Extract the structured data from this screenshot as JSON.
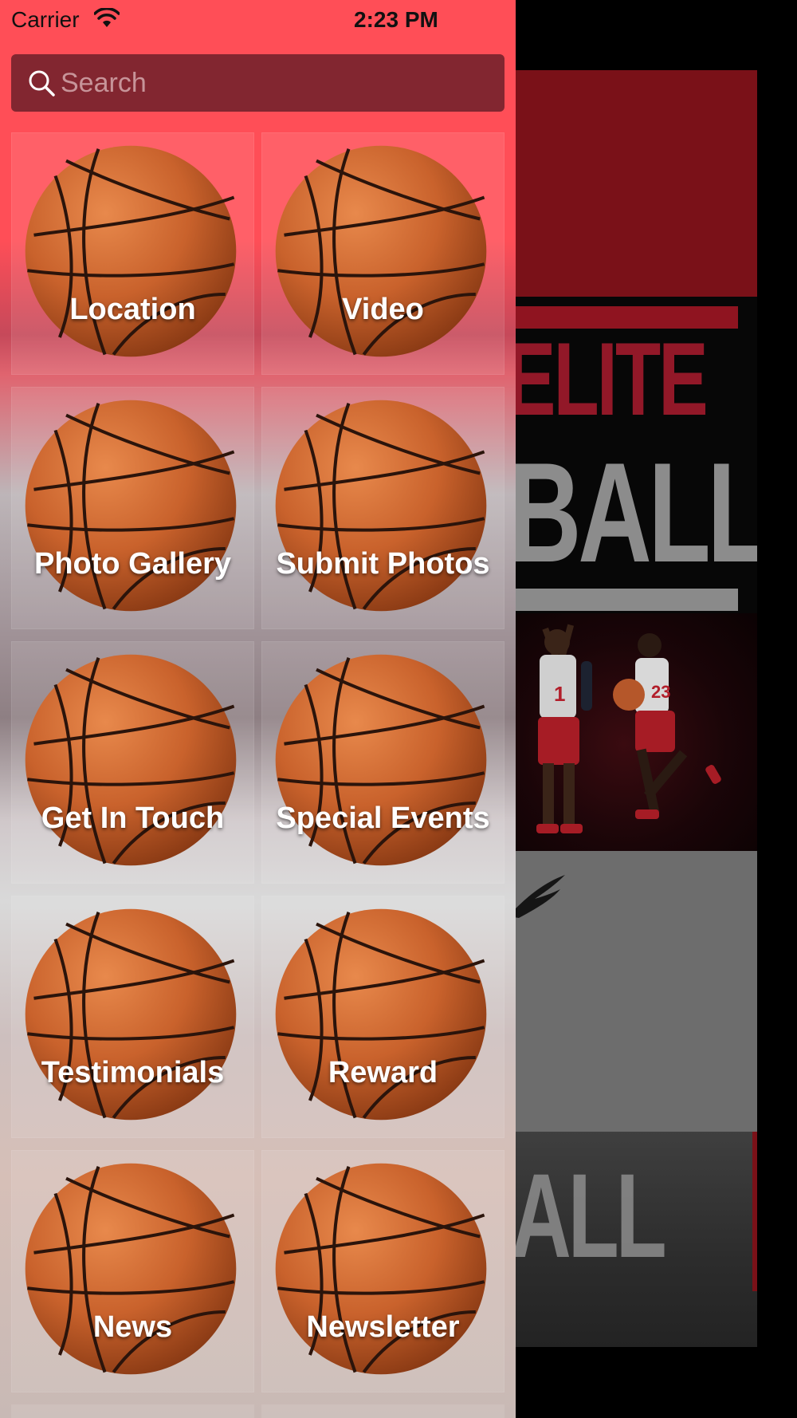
{
  "status_bar": {
    "carrier": "Carrier",
    "time": "2:23 PM"
  },
  "search": {
    "placeholder": "Search"
  },
  "menu_items": [
    {
      "label": "Location",
      "icon": "basketball-icon"
    },
    {
      "label": "Video",
      "icon": "basketball-icon"
    },
    {
      "label": "Photo Gallery",
      "icon": "basketball-icon"
    },
    {
      "label": "Submit Photos",
      "icon": "basketball-icon"
    },
    {
      "label": "Get In Touch",
      "icon": "basketball-icon"
    },
    {
      "label": "Special Events",
      "icon": "basketball-icon"
    },
    {
      "label": "Testimonials",
      "icon": "basketball-icon"
    },
    {
      "label": "Reward",
      "icon": "basketball-icon"
    },
    {
      "label": "News",
      "icon": "basketball-icon"
    },
    {
      "label": "Newsletter",
      "icon": "basketball-icon"
    }
  ],
  "background": {
    "logo_line1": "ELITE",
    "logo_line2": "BALL",
    "bottom_text": "ALL",
    "player_numbers": [
      "1",
      "23"
    ]
  },
  "colors": {
    "menu_accent": "#ff4e57",
    "search_bar": "#822630",
    "brand_red": "#7a1118"
  }
}
